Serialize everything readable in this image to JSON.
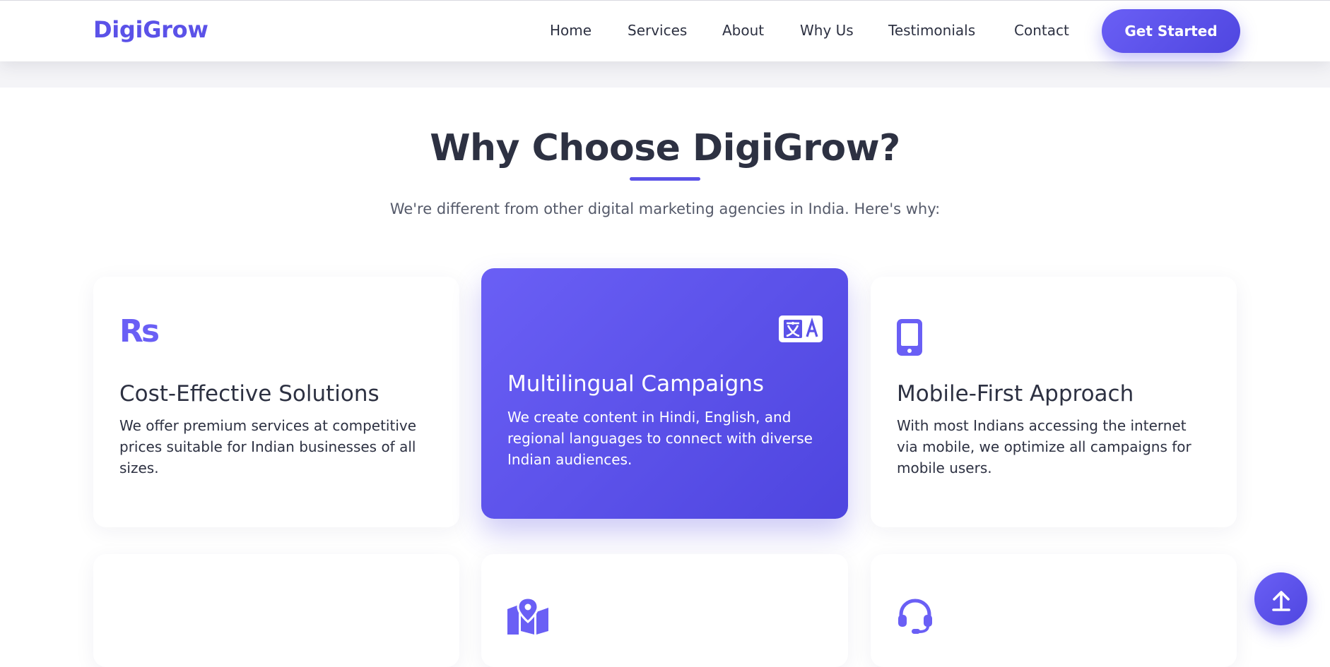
{
  "header": {
    "logo": "DigiGrow",
    "nav": [
      "Home",
      "Services",
      "About",
      "Why Us",
      "Testimonials",
      "Contact"
    ],
    "cta_label": "Get Started"
  },
  "section": {
    "title": "Why Choose DigiGrow?",
    "subtitle": "We're different from other digital marketing agencies in India. Here's why:"
  },
  "cards": [
    {
      "icon": "rupee-icon",
      "icon_text": "Rs",
      "title": "Cost-Effective Solutions",
      "text": "We offer premium services at competitive prices suitable for Indian businesses of all sizes."
    },
    {
      "icon": "language-icon",
      "title": "Multilingual Campaigns",
      "text": "We create content in Hindi, English, and regional languages to connect with diverse Indian audiences.",
      "featured": true
    },
    {
      "icon": "mobile-icon",
      "title": "Mobile-First Approach",
      "text": "With most Indians accessing the internet via mobile, we optimize all campaigns for mobile users."
    },
    {
      "icon": ""
    },
    {
      "icon": "map-icon"
    },
    {
      "icon": "headset-icon"
    }
  ],
  "colors": {
    "accent": "#5b52e8",
    "accent_gradient_start": "#6a5ff5",
    "accent_gradient_end": "#4e45df",
    "text": "#2d3142"
  },
  "scroll_top": {
    "icon": "arrow-up-icon"
  }
}
